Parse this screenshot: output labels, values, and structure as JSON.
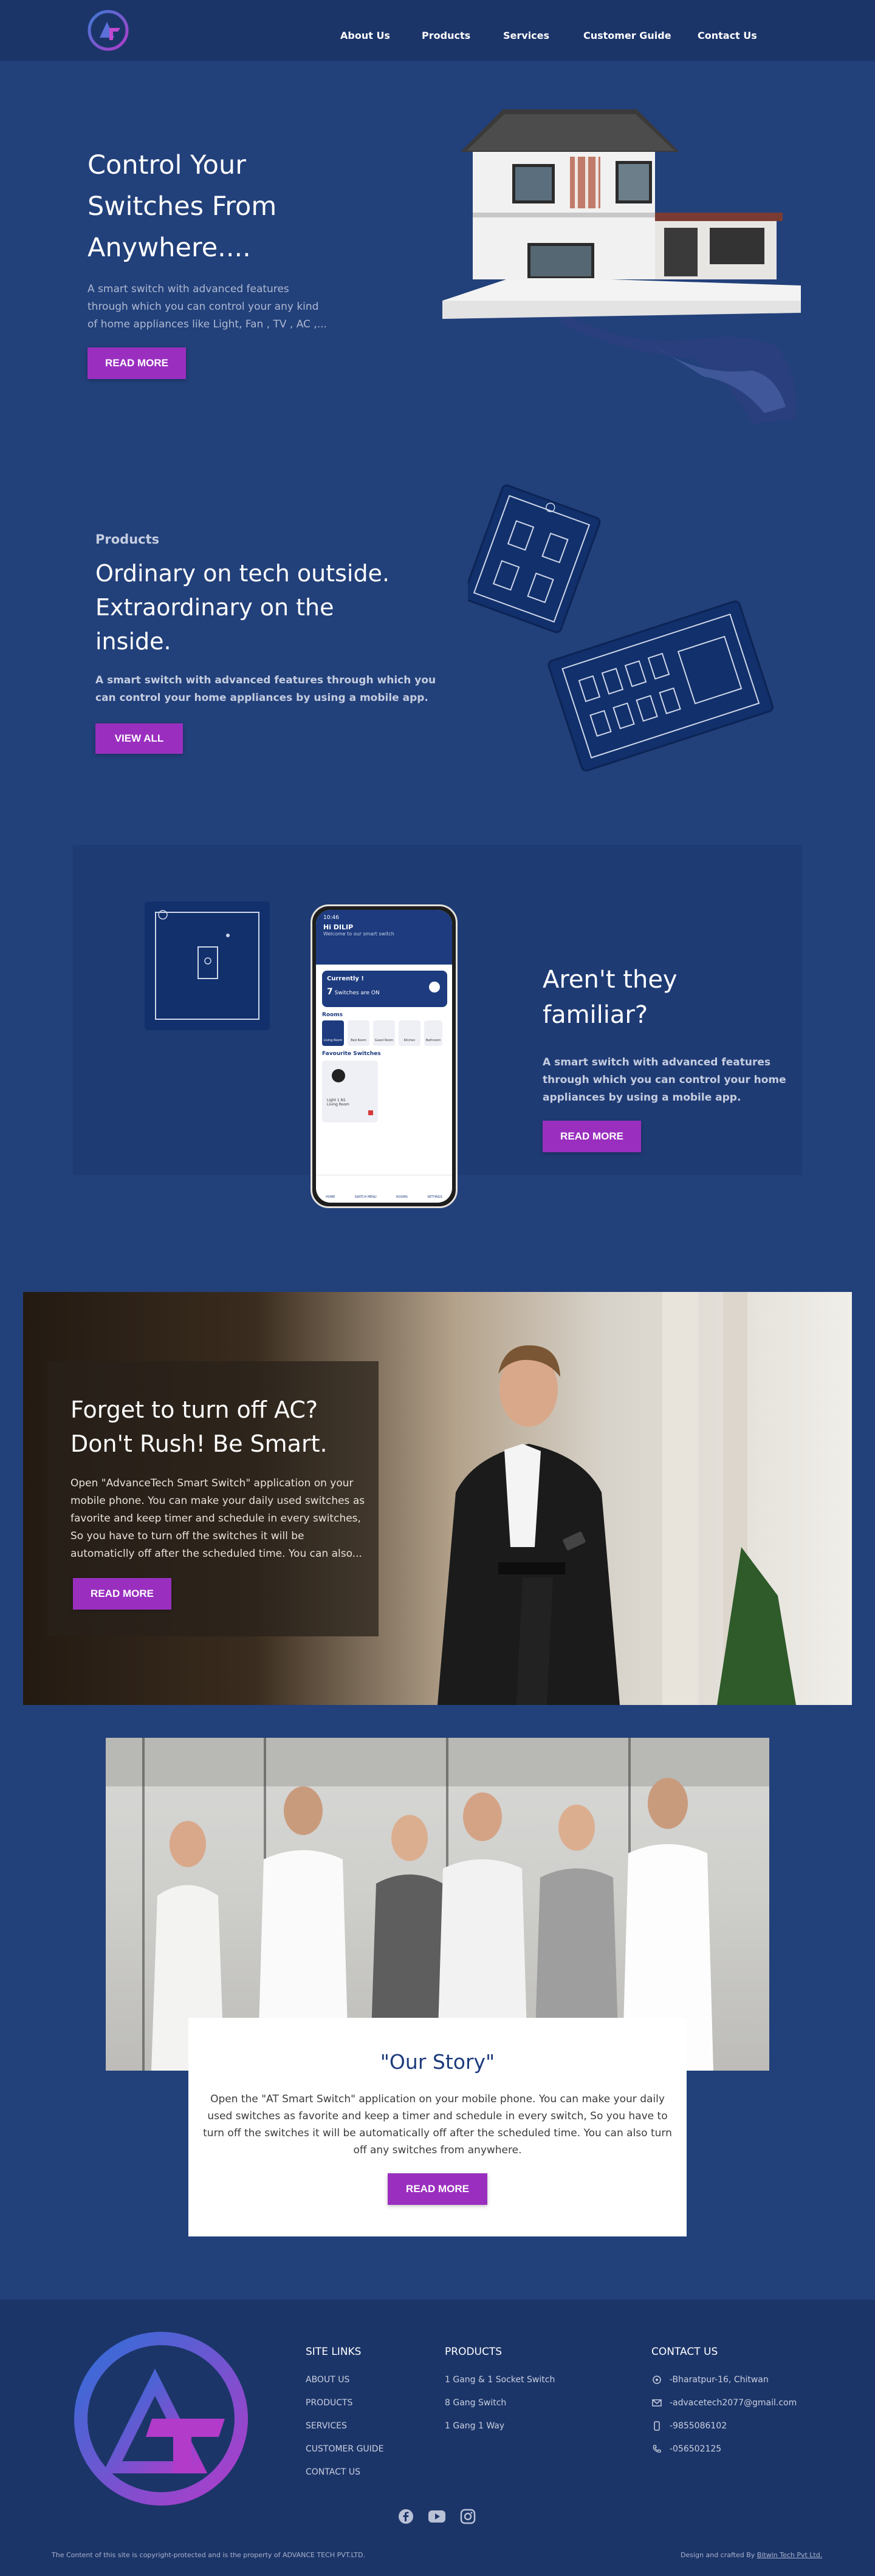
{
  "nav": {
    "items": [
      "About Us",
      "Products",
      "Services",
      "Customer Guide",
      "Contact Us"
    ]
  },
  "hero": {
    "title_line1": "Control Your",
    "title_line2": "Switches From",
    "title_line3": "Anywhere....",
    "desc_line1": "A smart switch with advanced features",
    "desc_line2": "through which you can control your any kind",
    "desc_line3": "of home appliances like Light, Fan , TV , AC ,...",
    "button": "READ MORE"
  },
  "products": {
    "eyebrow": "Products",
    "title_line1": "Ordinary on tech outside.",
    "title_line2": "Extraordinary on the",
    "title_line3": "inside.",
    "desc_line1": "A smart switch with advanced features through which you",
    "desc_line2": "can control your home appliances by using a mobile app.",
    "button": "VIEW ALL"
  },
  "familiar": {
    "title_line1": "Aren't they",
    "title_line2": "familiar?",
    "desc_line1": "A smart switch with advanced features",
    "desc_line2": "through which you can control your home",
    "desc_line3": "appliances by using a mobile app.",
    "button": "READ MORE",
    "phone": {
      "time": "10:46",
      "greeting": "Hi DILIP",
      "welcome": "Welcome to our smart switch",
      "currently_label": "Currently !",
      "switches_on_count": "7",
      "switches_on_text": "Switches are ON",
      "rooms_label": "Rooms",
      "rooms": [
        "Living Room",
        "Bed Room",
        "Guest Room",
        "Kitchen",
        "Bathroom"
      ],
      "favourites_label": "Favourite Switches",
      "fav_name": "Light 1 N1",
      "fav_room": "Living Room",
      "tabs": [
        "HOME",
        "SWITCH MENU",
        "ROOMS",
        "SETTINGS"
      ]
    }
  },
  "ac": {
    "title_line1": "Forget to turn off AC?",
    "title_line2": "Don't Rush! Be Smart.",
    "desc_line1": "Open \"AdvanceTech Smart Switch\" application on your",
    "desc_line2": "mobile phone. You can make your daily used switches as",
    "desc_line3": "favorite and keep timer and schedule in every switches,",
    "desc_line4": "So you have to turn off the switches it will be",
    "desc_line5": "automaticlly off after the scheduled time. You can also...",
    "button": "READ MORE"
  },
  "story": {
    "title": "\"Our Story\"",
    "line1": "Open the \"AT Smart Switch\" application on your mobile phone. You can make your daily",
    "line2": "used switches as favorite and keep a timer and schedule in every switch, So you have to",
    "line3": "turn off the switches it will be automatically off after the scheduled time. You can also turn",
    "line4": "off any switches from anywhere.",
    "button": "READ MORE"
  },
  "footer": {
    "site_links_title": "SITE LINKS",
    "site_links": [
      "ABOUT US",
      "PRODUCTS",
      "SERVICES",
      "CUSTOMER GUIDE",
      "CONTACT US"
    ],
    "products_title": "PRODUCTS",
    "products": [
      "1 Gang & 1 Socket Switch",
      "8 Gang Switch",
      "1 Gang 1 Way"
    ],
    "contact_title": "CONTACT US",
    "contact": [
      "-Bharatpur-16, Chitwan",
      "-advacetech2077@gmail.com",
      "-9855086102",
      "-056502125"
    ],
    "copyright": "The Content of this site is copyright-protected and is the property of ADVANCE TECH PVT.LTD.",
    "credit_prefix": "Design and crafted By",
    "credit_link": "Bitwin Tech Pvt Ltd."
  },
  "colors": {
    "page_bg": "#22407a",
    "header_bg": "#1c3569",
    "accent": "#9a2fbf",
    "footer_bg": "#1c3569"
  }
}
